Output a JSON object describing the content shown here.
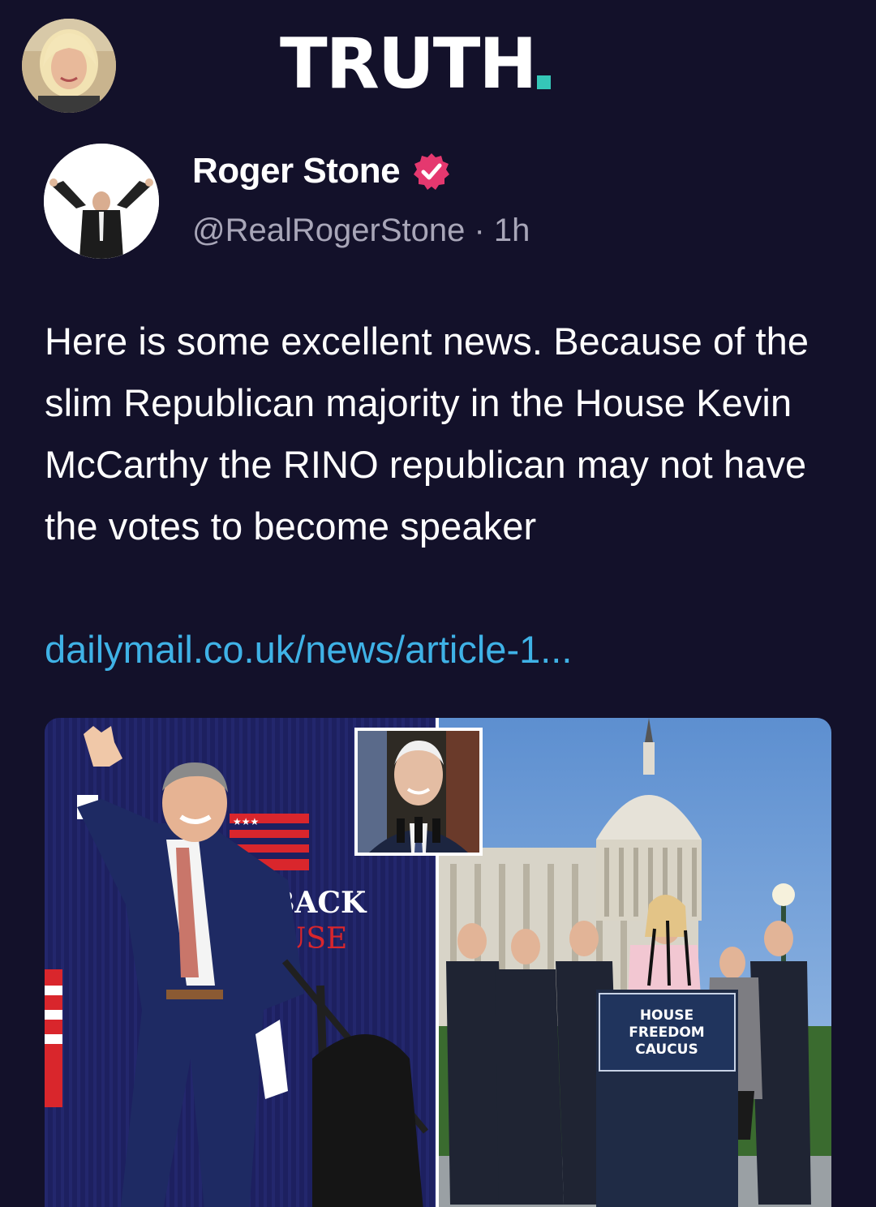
{
  "header": {
    "logo_text": "TRUTH",
    "logo_dot_color": "#35c7b8",
    "profile_avatar_icon": "user-avatar"
  },
  "post": {
    "author": {
      "name": "Roger Stone",
      "verified_icon": "verified-badge-icon",
      "verified_color": "#e5386f",
      "handle": "@RealRogerStone",
      "separator": "·",
      "time": "1h",
      "meta": "@RealRogerStone · 1h"
    },
    "text": "Here is some excellent news. Because of the slim Republican majority in the House Kevin McCarthy the RINO republican may not have the votes to become speaker",
    "link": "dailymail.co.uk/news/article-1...",
    "link_color": "#3fb2e6",
    "media": {
      "left_sign_line1": "BACK",
      "left_sign_line2": "USE",
      "podium_line1": "HOUSE",
      "podium_line2": "FREEDOM",
      "podium_line3": "CAUCUS"
    }
  }
}
